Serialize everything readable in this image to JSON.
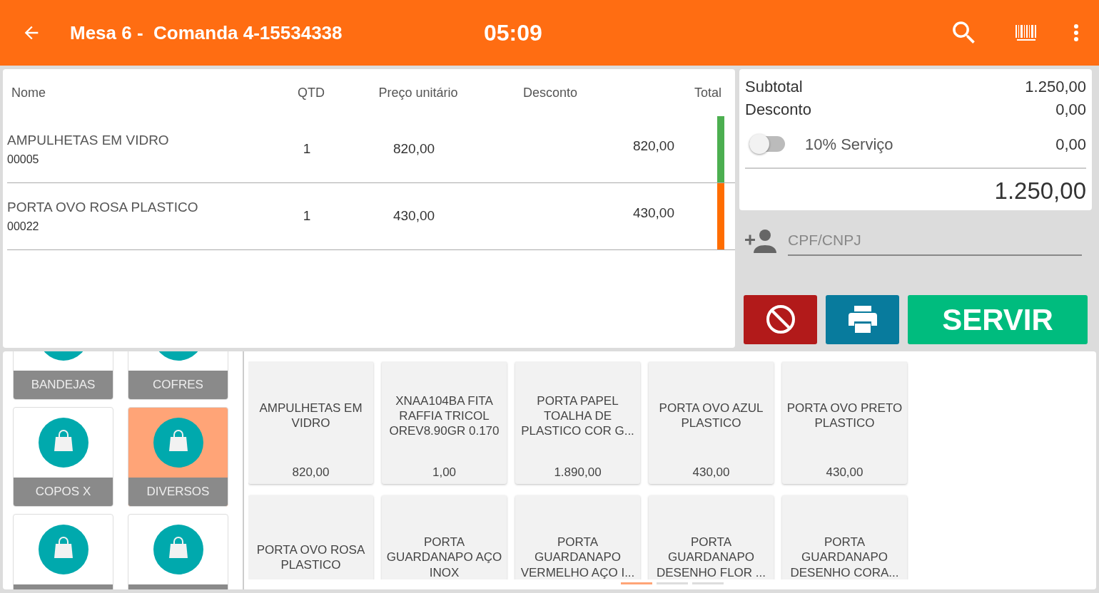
{
  "header": {
    "title": "Mesa 6 -  Comanda 4-15534338",
    "time": "05:09"
  },
  "table": {
    "columns": [
      "Nome",
      "QTD",
      "Preço unitário",
      "Desconto",
      "Total"
    ],
    "rows": [
      {
        "name": "AMPULHETAS EM VIDRO",
        "code": "00005",
        "qty": "1",
        "price": "820,00",
        "total": "820,00",
        "color": "#4caf50"
      },
      {
        "name": "PORTA OVO ROSA PLASTICO",
        "code": "00022",
        "qty": "1",
        "price": "430,00",
        "total": "430,00",
        "color": "#ff6d00"
      }
    ]
  },
  "summary": {
    "subtotal_label": "Subtotal",
    "subtotal": "1.250,00",
    "discount_label": "Desconto",
    "discount": "0,00",
    "service_label": "10% Serviço",
    "service_on": false,
    "service": "0,00",
    "total": "1.250,00"
  },
  "customer": {
    "placeholder": "CPF/CNPJ"
  },
  "actions": {
    "serve": "SERVIR"
  },
  "categories": [
    {
      "label": "BANDEJAS",
      "selected": false
    },
    {
      "label": "COFRES",
      "selected": false
    },
    {
      "label": "COPOS X",
      "selected": false
    },
    {
      "label": "DIVERSOS",
      "selected": true
    },
    {
      "selected": false
    },
    {
      "selected": false
    }
  ],
  "products": [
    {
      "name": "AMPULHETAS EM VIDRO",
      "price": "820,00"
    },
    {
      "name": "XNAA104BA FITA RAFFIA TRICOL OREV8.90GR 0.170",
      "price": "1,00"
    },
    {
      "name": "PORTA PAPEL TOALHA DE PLASTICO COR G...",
      "price": "1.890,00"
    },
    {
      "name": "PORTA OVO AZUL PLASTICO",
      "price": "430,00"
    },
    {
      "name": "PORTA OVO PRETO PLASTICO",
      "price": "430,00"
    },
    {
      "name": "PORTA OVO ROSA PLASTICO"
    },
    {
      "name": "PORTA GUARDANAPO AÇO INOX"
    },
    {
      "name": "PORTA GUARDANAPO VERMELHO AÇO I..."
    },
    {
      "name": "PORTA GUARDANAPO DESENHO FLOR ..."
    },
    {
      "name": "PORTA GUARDANAPO DESENHO CORA..."
    }
  ],
  "pager": [
    {
      "selected": true
    },
    {
      "selected": false
    },
    {
      "selected": false
    }
  ]
}
